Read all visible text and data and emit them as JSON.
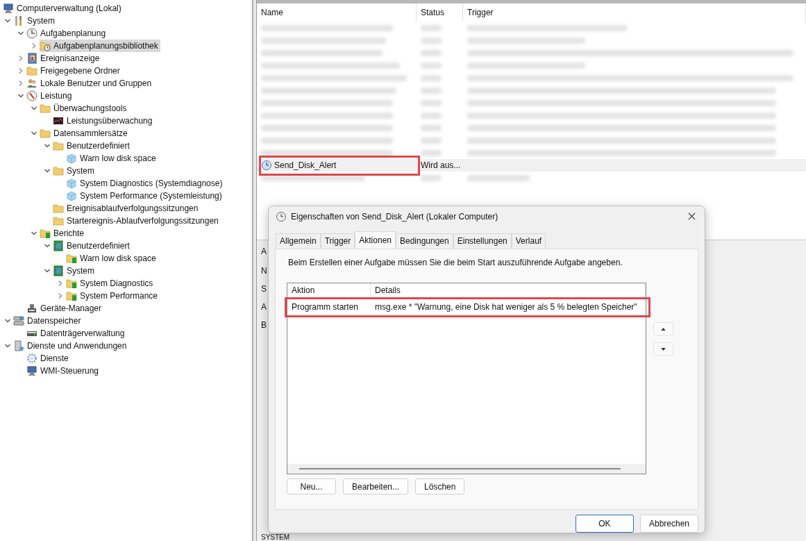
{
  "tree": {
    "root": {
      "label": "Computerverwaltung (Lokal)",
      "kind": "computer",
      "selected": false,
      "children": [
        {
          "label": "System",
          "kind": "tools",
          "expandable": true,
          "expanded": true,
          "selected": false,
          "children": [
            {
              "label": "Aufgabenplanung",
              "kind": "clock",
              "expandable": true,
              "expanded": true,
              "selected": false,
              "children": [
                {
                  "label": "Aufgabenplanungsbibliothek",
                  "kind": "folder-clock",
                  "expandable": true,
                  "expanded": false,
                  "selected": true
                }
              ]
            },
            {
              "label": "Ereignisanzeige",
              "kind": "book",
              "expandable": true,
              "expanded": false,
              "selected": false
            },
            {
              "label": "Freigegebene Ordner",
              "kind": "folder",
              "expandable": true,
              "expanded": false,
              "selected": false
            },
            {
              "label": "Lokale Benutzer und Gruppen",
              "kind": "users",
              "expandable": true,
              "expanded": false,
              "selected": false
            },
            {
              "label": "Leistung",
              "kind": "gauge",
              "expandable": true,
              "expanded": true,
              "selected": false,
              "children": [
                {
                  "label": "Überwachungstools",
                  "kind": "folder",
                  "expandable": true,
                  "expanded": true,
                  "selected": false,
                  "children": [
                    {
                      "label": "Leistungsüberwachung",
                      "kind": "chart",
                      "expandable": false,
                      "selected": false
                    }
                  ]
                },
                {
                  "label": "Datensammlersätze",
                  "kind": "folder",
                  "expandable": true,
                  "expanded": true,
                  "selected": false,
                  "children": [
                    {
                      "label": "Benutzerdefiniert",
                      "kind": "folder",
                      "expandable": true,
                      "expanded": true,
                      "selected": false,
                      "children": [
                        {
                          "label": "Warn low disk space",
                          "kind": "cube",
                          "expandable": false,
                          "selected": false
                        }
                      ]
                    },
                    {
                      "label": "System",
                      "kind": "folder",
                      "expandable": true,
                      "expanded": true,
                      "selected": false,
                      "children": [
                        {
                          "label": "System Diagnostics (Systemdiagnose)",
                          "kind": "cube",
                          "expandable": false,
                          "selected": false
                        },
                        {
                          "label": "System Performance (Systemleistung)",
                          "kind": "cube",
                          "expandable": false,
                          "selected": false
                        }
                      ]
                    },
                    {
                      "label": "Ereignisablaufverfolgungssitzungen",
                      "kind": "folder",
                      "expandable": false,
                      "selected": false
                    },
                    {
                      "label": "Startereignis-Ablaufverfolgungssitzungen",
                      "kind": "folder",
                      "expandable": false,
                      "selected": false
                    }
                  ]
                },
                {
                  "label": "Berichte",
                  "kind": "folder-report",
                  "expandable": true,
                  "expanded": true,
                  "selected": false,
                  "children": [
                    {
                      "label": "Benutzerdefiniert",
                      "kind": "report",
                      "expandable": true,
                      "expanded": true,
                      "selected": false,
                      "children": [
                        {
                          "label": "Warn low disk space",
                          "kind": "folder-report",
                          "expandable": false,
                          "selected": false
                        }
                      ]
                    },
                    {
                      "label": "System",
                      "kind": "report",
                      "expandable": true,
                      "expanded": true,
                      "selected": false,
                      "children": [
                        {
                          "label": "System Diagnostics",
                          "kind": "folder-report",
                          "expandable": true,
                          "expanded": false,
                          "selected": false
                        },
                        {
                          "label": "System Performance",
                          "kind": "folder-report",
                          "expandable": true,
                          "expanded": false,
                          "selected": false
                        }
                      ]
                    }
                  ]
                }
              ]
            },
            {
              "label": "Geräte-Manager",
              "kind": "device",
              "expandable": false,
              "selected": false
            }
          ]
        },
        {
          "label": "Datenspeicher",
          "kind": "drives",
          "expandable": true,
          "expanded": true,
          "selected": false,
          "children": [
            {
              "label": "Datenträgerverwaltung",
              "kind": "drive",
              "expandable": false,
              "selected": false
            }
          ]
        },
        {
          "label": "Dienste und Anwendungen",
          "kind": "server",
          "expandable": true,
          "expanded": true,
          "selected": false,
          "children": [
            {
              "label": "Dienste",
              "kind": "gear",
              "expandable": false,
              "selected": false
            },
            {
              "label": "WMI-Steuerung",
              "kind": "computer",
              "expandable": false,
              "selected": false
            }
          ]
        }
      ]
    }
  },
  "task_list": {
    "columns": [
      "Name",
      "Status",
      "Trigger"
    ],
    "rows": [
      {
        "kind": "blurred",
        "selected": false
      },
      {
        "kind": "blurred",
        "selected": false
      },
      {
        "kind": "blurred",
        "selected": false
      },
      {
        "kind": "blurred",
        "selected": false
      },
      {
        "kind": "blurred",
        "selected": false
      },
      {
        "kind": "blurred",
        "selected": false
      },
      {
        "kind": "blurred",
        "selected": false
      },
      {
        "kind": "blurred",
        "selected": false
      },
      {
        "kind": "blurred",
        "selected": false
      },
      {
        "kind": "blurred",
        "selected": false
      },
      {
        "kind": "blurred",
        "selected": false
      },
      {
        "kind": "task",
        "name": "Send_Disk_Alert",
        "status": "Wird aus...",
        "selected": true,
        "highlighted": true
      },
      {
        "kind": "blurred",
        "selected": false
      }
    ]
  },
  "lower_panel": {
    "tab_fragment": "A",
    "field_fragments": [
      "N",
      "S",
      "A",
      "B"
    ],
    "footer_fragment": "SYSTEM"
  },
  "dialog": {
    "title": "Eigenschaften von Send_Disk_Alert (Lokaler Computer)",
    "tabs": [
      {
        "label": "Allgemein",
        "selected": false
      },
      {
        "label": "Trigger",
        "selected": false
      },
      {
        "label": "Aktionen",
        "selected": true
      },
      {
        "label": "Bedingungen",
        "selected": false
      },
      {
        "label": "Einstellungen",
        "selected": false
      },
      {
        "label": "Verlauf",
        "selected": false
      }
    ],
    "description": "Beim Erstellen einer Aufgabe müssen Sie die beim Start auszuführende Aufgabe angeben.",
    "actions_table": {
      "columns": [
        "Aktion",
        "Details"
      ],
      "rows": [
        {
          "action": "Programm starten",
          "details": "msg.exe * \"Warnung, eine Disk hat weniger als 5 % belegten Speicher\"",
          "highlighted": true
        }
      ]
    },
    "list_buttons": [
      "Neu...",
      "Bearbeiten...",
      "Löschen"
    ],
    "footer_buttons": [
      {
        "label": "OK",
        "kind": "default"
      },
      {
        "label": "Abbrechen",
        "kind": "normal"
      }
    ]
  }
}
